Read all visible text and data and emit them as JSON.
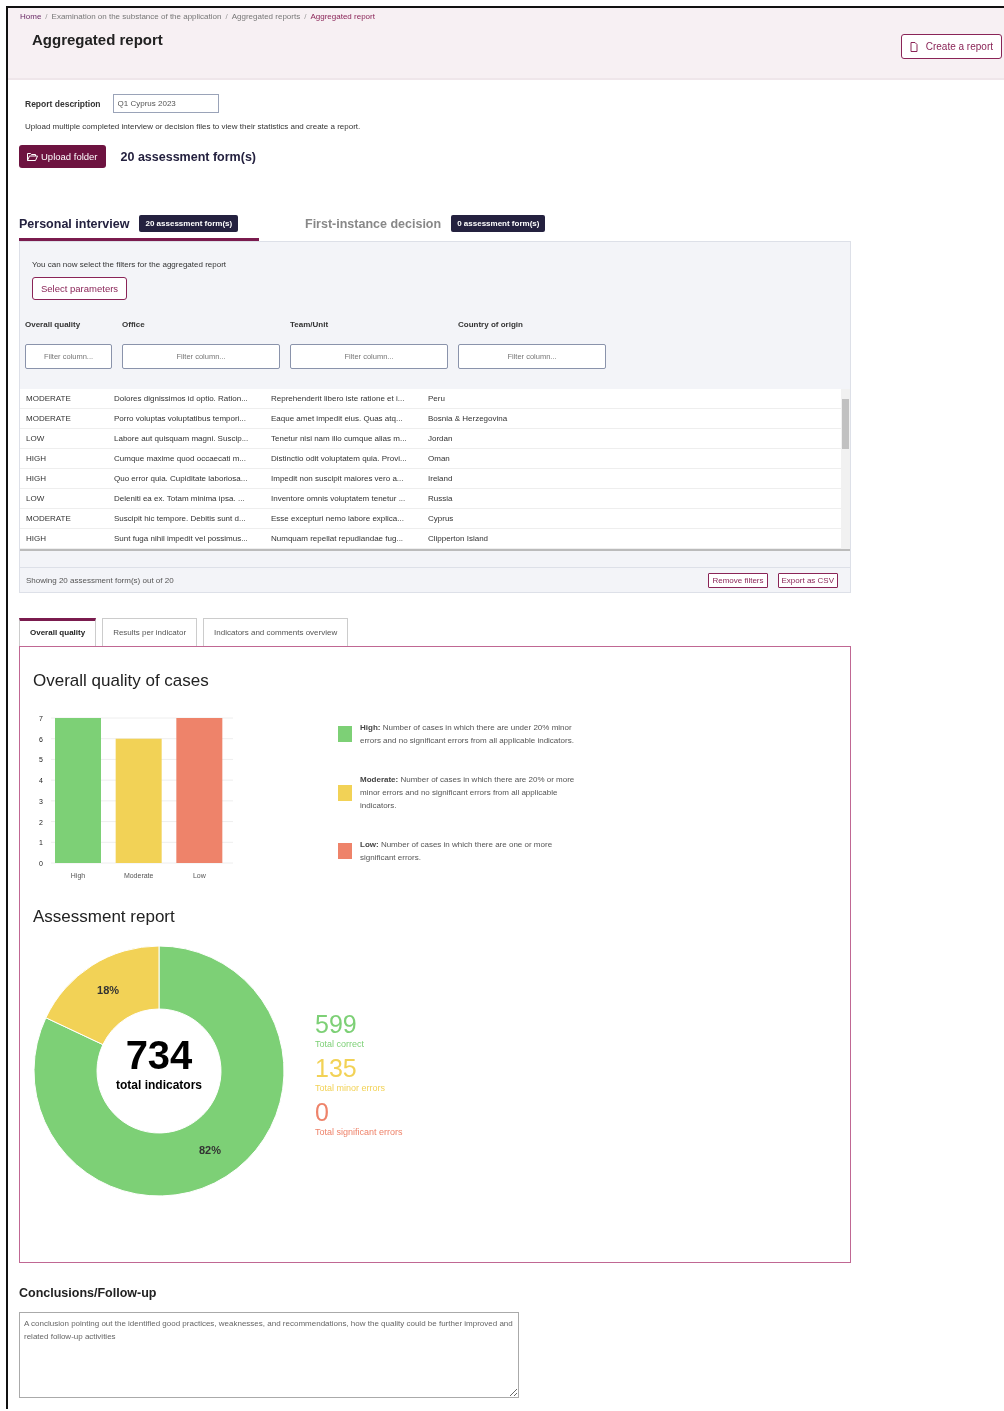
{
  "breadcrumb": [
    {
      "label": "Home",
      "current": false
    },
    {
      "separator": "/",
      "label": "Examination on the substance of the application",
      "current": false
    },
    {
      "separator": "/",
      "label": "Aggregated reports",
      "current": false
    },
    {
      "separator": "/",
      "label": "Aggregated report",
      "current": true
    }
  ],
  "page_title": "Aggregated report",
  "create_button": "Create a report",
  "report_description": {
    "label": "Report description",
    "value": "Q1 Cyprus 2023"
  },
  "upload_hint": "Upload multiple completed interview or decision files to view their statistics and create a report.",
  "upload_button": "Upload folder",
  "form_count": "20 assessment form(s)",
  "source_tabs": [
    {
      "label": "Personal interview",
      "badge": "20 assessment form(s)",
      "selected": true
    },
    {
      "label": "First-instance decision",
      "badge": "0 assessment form(s)",
      "selected": false
    }
  ],
  "filters_hint": "You can now select the filters for the aggregated report",
  "select_button": "Select parameters",
  "table": {
    "columns": [
      {
        "label": "Overall quality",
        "placeholder": "Filter column..."
      },
      {
        "label": "Office",
        "placeholder": "Filter column..."
      },
      {
        "label": "Team/Unit",
        "placeholder": "Filter column..."
      },
      {
        "label": "Country of origin",
        "placeholder": "Filter column..."
      }
    ],
    "rows": [
      [
        "MODERATE",
        "Dolores dignissimos id optio. Ration...",
        "Reprehenderit libero iste ratione et i...",
        "Peru"
      ],
      [
        "MODERATE",
        "Porro voluptas voluptatibus tempori...",
        "Eaque amet impedit eius. Quas atq...",
        "Bosnia & Herzegovina"
      ],
      [
        "LOW",
        "Labore aut quisquam magni. Suscip...",
        "Tenetur nisi nam illo cumque alias m...",
        "Jordan"
      ],
      [
        "HIGH",
        "Cumque maxime quod occaecati m...",
        "Distinctio odit voluptatem quia. Provi...",
        "Oman"
      ],
      [
        "HIGH",
        "Quo error quia. Cupiditate laboriosa...",
        "Impedit non suscipit maiores vero a...",
        "Ireland"
      ],
      [
        "LOW",
        "Deleniti ea ex. Totam minima ipsa. ...",
        "Inventore omnis voluptatem tenetur ...",
        "Russia"
      ],
      [
        "MODERATE",
        "Suscipit hic tempore. Debitis sunt d...",
        "Esse excepturi nemo labore explica...",
        "Cyprus"
      ],
      [
        "HIGH",
        "Sunt fuga nihil impedit vel possimus...",
        "Numquam repellat repudiandae fug...",
        "Clipperton Island"
      ]
    ]
  },
  "table_status": "Showing 20 assessment form(s) out of 20",
  "table_buttons": [
    "Remove filters",
    "Export as CSV"
  ],
  "result_tabs": [
    {
      "label": "Overall quality",
      "selected": true
    },
    {
      "label": "Results per indicator",
      "selected": false
    },
    {
      "label": "Indicators and comments overview",
      "selected": false
    }
  ],
  "quality_title": "Overall quality of cases",
  "quality_chart": {
    "chart_data": {
      "type": "bar",
      "categories": [
        "High",
        "Moderate",
        "Low"
      ],
      "yticks": [
        0,
        1,
        2,
        3,
        4,
        5,
        6,
        7
      ],
      "ylim": [
        0,
        7
      ],
      "grid": true,
      "values": [
        7,
        6,
        7
      ],
      "colors": [
        "#7dd076",
        "#f2d256",
        "#ee836a"
      ]
    }
  },
  "legend": [
    {
      "color": "#7dd076",
      "text": "**High:** Number of cases in which there are under 20% minor errors and no significant errors from all applicable indicators."
    },
    {
      "color": "#f2d256",
      "text": "**Moderate:** Number of cases in which there are 20% or more minor errors and no significant errors from all applicable indicators."
    },
    {
      "color": "#ee836a",
      "text": "**Low:** Number of cases in which there are one or more significant errors."
    }
  ],
  "assessment_title": "Assessment report",
  "donut": {
    "chart_data": {
      "type": "donut",
      "values": [
        82,
        18
      ],
      "value_labels": [
        "82%",
        "18%"
      ],
      "colors": [
        "#7dd076",
        "#f2d256"
      ]
    },
    "center_value": "734",
    "center_label": "total indicators"
  },
  "totals": [
    {
      "value": "599",
      "label": "Total correct",
      "color": "#7dd076"
    },
    {
      "value": "135",
      "label": "Total minor errors",
      "color": "#f2d256"
    },
    {
      "value": "0",
      "label": "Total significant errors",
      "color": "#ee836a"
    }
  ],
  "conclusions": {
    "title": "Conclusions/Follow-up",
    "placeholder": "A conclusion pointing out the identified good practices, weaknesses, and recommendations, how the quality could be further improved and related follow-up activities"
  }
}
